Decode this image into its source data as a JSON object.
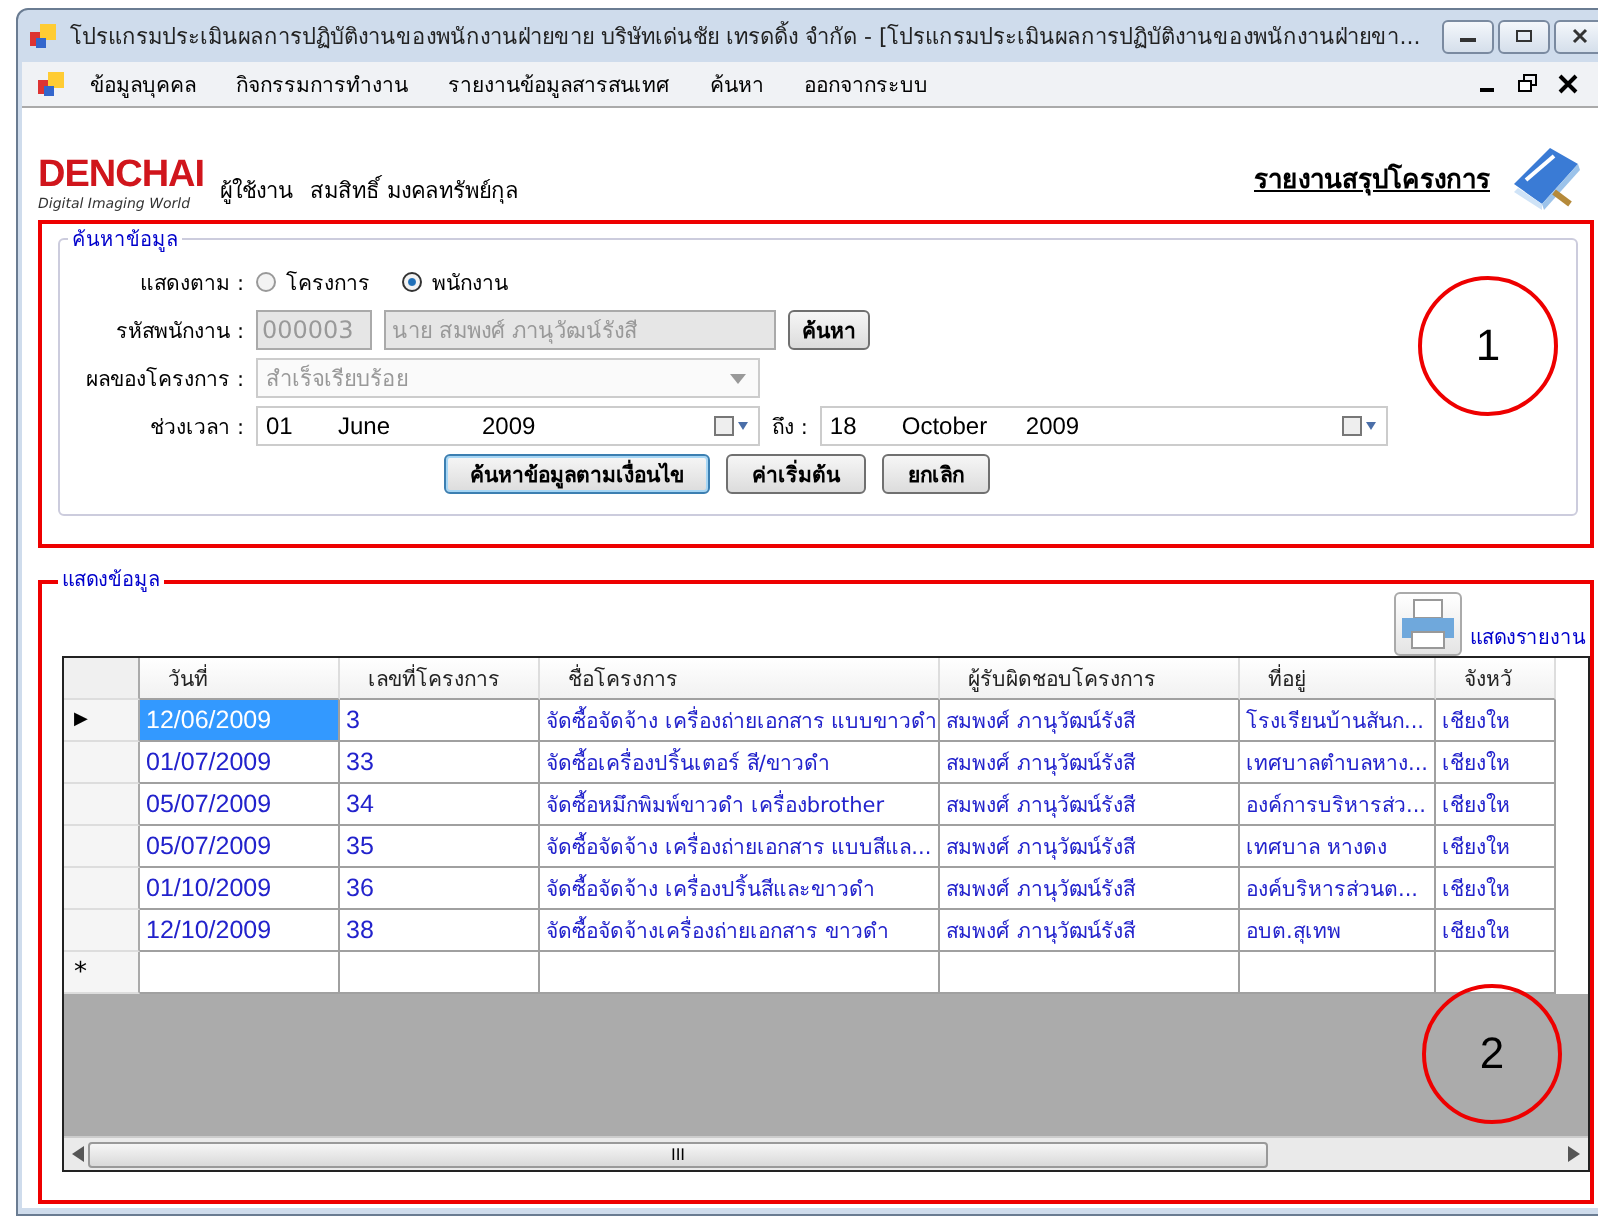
{
  "window": {
    "title": "โปรแกรมประเมินผลการปฏิบัติงานของพนักงานฝ่ายขาย บริษัทเด่นชัย เทรดดิ้ง จำกัด - [โปรแกรมประเมินผลการปฏิบัติงานของพนักงานฝ่ายขา..."
  },
  "menu": [
    "ข้อมูลบุคคล",
    "กิจกรรมการทำงาน",
    "รายงานข้อมูลสารสนเทศ",
    "ค้นหา",
    "ออกจากระบบ"
  ],
  "header": {
    "logo": "DENCHAI",
    "logo_tagline": "Digital Imaging World",
    "user_label": "ผู้ใช้งาน",
    "user_name": "สมสิทธิ์ มงคลทรัพย์กุล",
    "report_title": "รายงานสรุปโครงการ"
  },
  "search_panel": {
    "legend": "ค้นหาข้อมูล",
    "show_by_label": "แสดงตาม :",
    "show_by": [
      {
        "label": "โครงการ",
        "selected": false
      },
      {
        "label": "พนักงาน",
        "selected": true
      }
    ],
    "employee_id_label": "รหัสพนักงาน :",
    "employee_id": "000003",
    "employee_name": "นาย สมพงศ์ ภานุวัฒน์รังสี",
    "find_button": "ค้นหา",
    "result_label": "ผลของโครงการ :",
    "result": "สำเร็จเรียบร้อย",
    "period_label": "ช่วงเวลา :",
    "from": {
      "day": "01",
      "month": "June",
      "year": "2009"
    },
    "to_label": "ถึง :",
    "to": {
      "day": "18",
      "month": "October",
      "year": "2009"
    },
    "buttons": [
      "ค้นหาข้อมูลตามเงื่อนไข",
      "ค่าเริ่มต้น",
      "ยกเลิก"
    ]
  },
  "results_panel": {
    "legend": "แสดงข้อมูล",
    "report_link": "แสดงรายงาน",
    "table": {
      "columns": [
        "วันที่",
        "เลขที่โครงการ",
        "ชื่อโครงการ",
        "ผู้รับผิดชอบโครงการ",
        "ที่อยู่",
        "จังหวั"
      ],
      "rows": [
        {
          "selected": true,
          "cells": [
            "12/06/2009",
            "3",
            "จัดซื้อจัดจ้าง เครื่องถ่ายเอกสาร แบบขาวดำ",
            "สมพงศ์ ภานุวัฒน์รังสี",
            "โรงเรียนบ้านสันก...",
            "เชียงให"
          ]
        },
        {
          "selected": false,
          "cells": [
            "01/07/2009",
            "33",
            "จัดซื้อเครื่องปริ้นเตอร์ สี/ขาวดำ",
            "สมพงศ์ ภานุวัฒน์รังสี",
            "เทศบาลตำบลหาง...",
            "เชียงให"
          ]
        },
        {
          "selected": false,
          "cells": [
            "05/07/2009",
            "34",
            "จัดซื้อหมึกพิมพ์ขาวดำ เครื่องbrother",
            "สมพงศ์ ภานุวัฒน์รังสี",
            "องค์การบริหารส่ว...",
            "เชียงให"
          ]
        },
        {
          "selected": false,
          "cells": [
            "05/07/2009",
            "35",
            "จัดซื้อจัดจ้าง เครื่องถ่ายเอกสาร แบบสีแล...",
            "สมพงศ์ ภานุวัฒน์รังสี",
            "เทศบาล หางดง",
            "เชียงให"
          ]
        },
        {
          "selected": false,
          "cells": [
            "01/10/2009",
            "36",
            "จัดซื้อจัดจ้าง เครื่องปริ้นสีและขาวดำ",
            "สมพงศ์ ภานุวัฒน์รังสี",
            "องค์บริหารส่วนต...",
            "เชียงให"
          ]
        },
        {
          "selected": false,
          "cells": [
            "12/10/2009",
            "38",
            "จัดซื้อจัดจ้างเครื่องถ่ายเอกสาร ขาวดำ",
            "สมพงศ์ ภานุวัฒน์รังสี",
            "อบต.สุเทพ",
            "เชียงให"
          ]
        }
      ],
      "new_row_marker": "*",
      "current_row_marker": "▶",
      "scroll_thumb": "III"
    }
  },
  "annotations": [
    "1",
    "2"
  ]
}
